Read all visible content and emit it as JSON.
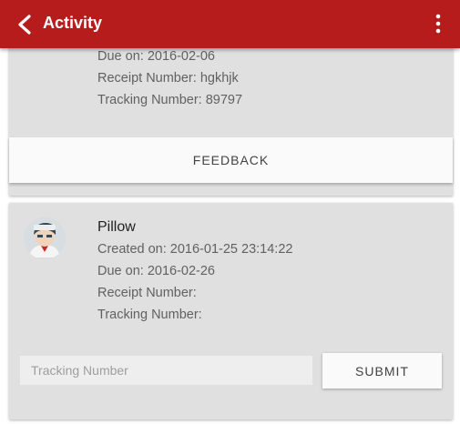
{
  "appbar": {
    "title": "Activity",
    "back_icon": "back-chevron-icon",
    "menu_icon": "more-vertical-icon",
    "color": "#b71c1c"
  },
  "cards": [
    {
      "due": "Due on: 2016-02-06",
      "receipt": "Receipt Number: hgkhjk",
      "tracking": "Tracking Number: 89797",
      "feedback_label": "FEEDBACK"
    },
    {
      "name": "Pillow",
      "created": "Created on: 2016-01-25 23:14:22",
      "due": "Due on: 2016-02-26",
      "receipt": "Receipt Number:",
      "tracking": "Tracking Number:",
      "tracking_placeholder": "Tracking Number",
      "submit_label": "SUBMIT"
    }
  ]
}
